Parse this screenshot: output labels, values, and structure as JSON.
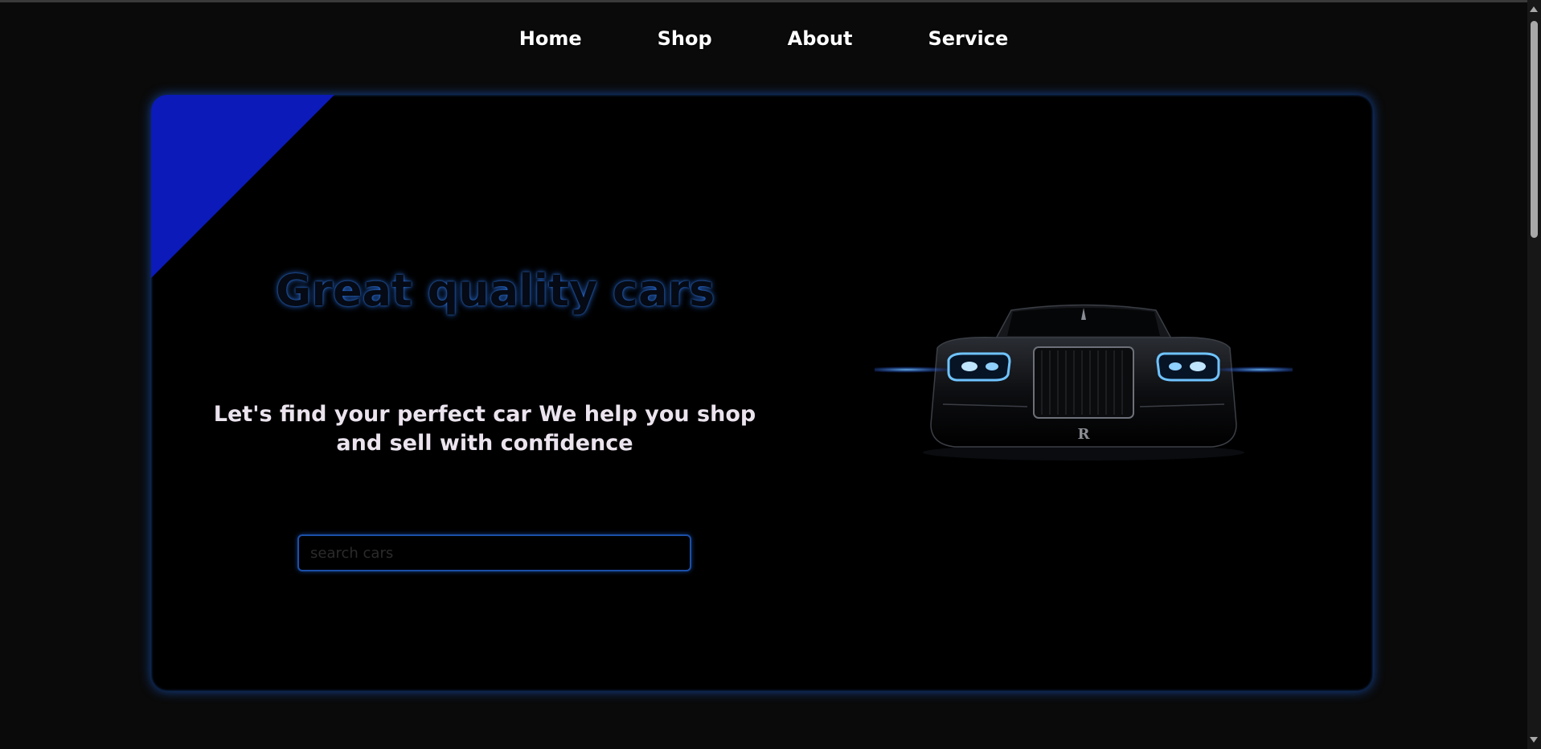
{
  "nav": {
    "items": [
      {
        "label": "Home"
      },
      {
        "label": "Shop"
      },
      {
        "label": "About"
      },
      {
        "label": "Service"
      }
    ]
  },
  "hero": {
    "title": "Great quality cars",
    "subtitle": "Let's find your perfect car We help you shop and sell with confidence",
    "search_placeholder": "search cars",
    "search_value": ""
  },
  "colors": {
    "background": "#0a0a0a",
    "panel": "#000000",
    "accent_blue": "#0b1ab8",
    "glow_blue": "#1b4fa8",
    "headlight": "#5fb4ff"
  }
}
